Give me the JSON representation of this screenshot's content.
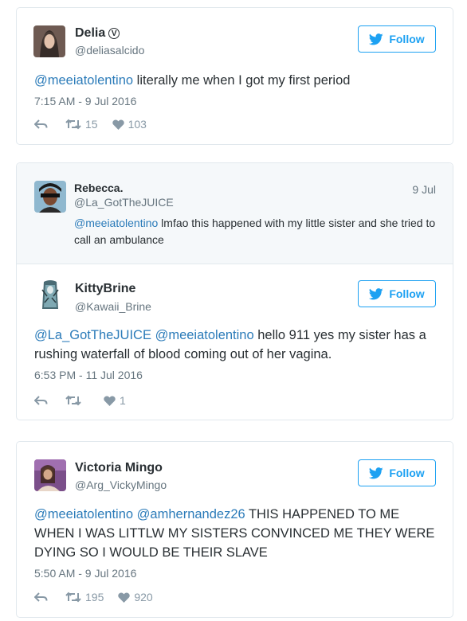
{
  "follow_label": "Follow",
  "colors": {
    "accent": "#1da1f2",
    "link": "#2b7bb9",
    "muted": "#66757f"
  },
  "tweet1": {
    "name": "Delia",
    "verified_badge": "Ⓥ",
    "handle": "@deliasalcido",
    "mention": "@meeiatolentino",
    "text": " literally me when I got my first period",
    "timestamp": "7:15 AM - 9 Jul 2016",
    "retweets": "15",
    "likes": "103"
  },
  "tweet2": {
    "context": {
      "name": "Rebecca.",
      "handle": "@La_GotTheJUICE",
      "date": "9 Jul",
      "mention": "@meeiatolentino",
      "text": " lmfao this happened with my little sister and she tried to call an ambulance"
    },
    "name": "KittyBrine",
    "handle": "@Kawaii_Brine",
    "mention1": "@La_GotTheJUICE",
    "mention2": "@meeiatolentino",
    "text": " hello 911 yes my sister has a rushing waterfall of blood coming out of her vagina.",
    "timestamp": "6:53 PM - 11 Jul 2016",
    "likes": "1"
  },
  "tweet3": {
    "name": "Victoria Mingo",
    "handle": "@Arg_VickyMingo",
    "mention1": "@meeiatolentino",
    "mention2": "@amhernandez26",
    "text": " THIS HAPPENED TO ME WHEN I WAS LITTLW MY SISTERS CONVINCED ME THEY WERE DYING SO I WOULD BE THEIR SLAVE",
    "timestamp": "5:50 AM - 9 Jul 2016",
    "retweets": "195",
    "likes": "920"
  }
}
